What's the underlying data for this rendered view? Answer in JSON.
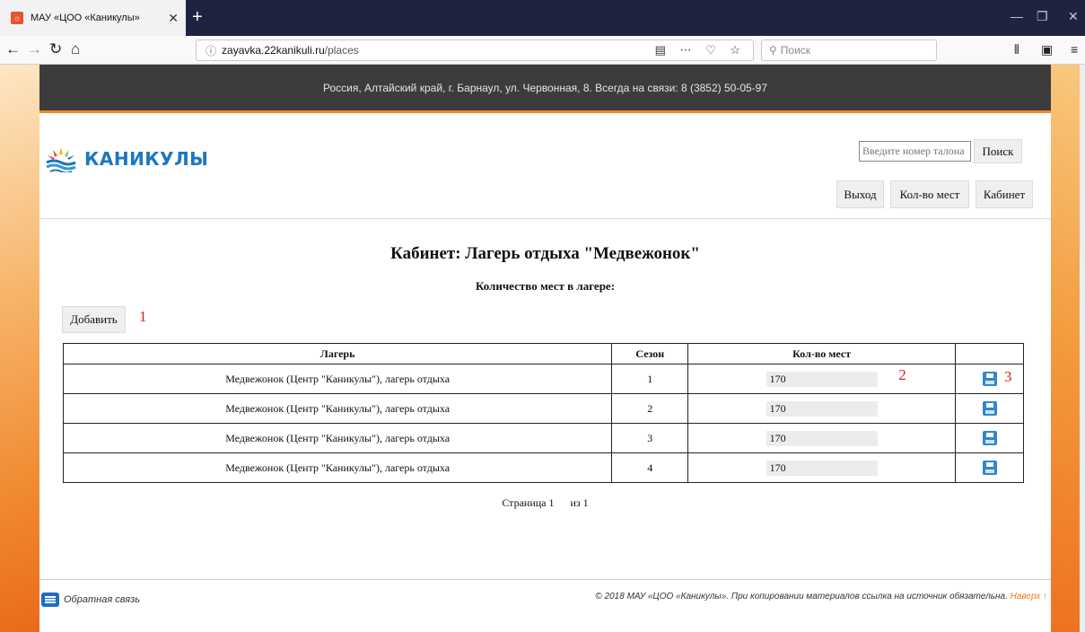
{
  "browser": {
    "tab_title": "МАУ «ЦОО «Каникулы»",
    "url_host": "zayavka.22kanikuli.ru",
    "url_path": "/places",
    "search_placeholder": "Поиск"
  },
  "site": {
    "top_info": "Россия, Алтайский край, г. Барнаул, ул. Червонная, 8.  Всегда на связи: 8 (3852) 50-05-97",
    "logo_text": "КАНИКУЛЫ",
    "search_placeholder": "Введите номер талона",
    "search_button": "Поиск",
    "nav": {
      "logout": "Выход",
      "places": "Кол-во мест",
      "cabinet": "Кабинет"
    }
  },
  "main": {
    "title": "Кабинет: Лагерь отдыха \"Медвежонок\"",
    "subtitle": "Количество мест в лагере:",
    "add_button": "Добавить",
    "markers": {
      "m1": "1",
      "m2": "2",
      "m3": "3"
    },
    "table": {
      "headers": [
        "Лагерь",
        "Сезон",
        "Кол-во мест",
        ""
      ],
      "rows": [
        {
          "camp": "Медвежонок (Центр \"Каникулы\"), лагерь отдыха",
          "season": "1",
          "places": "170"
        },
        {
          "camp": "Медвежонок (Центр \"Каникулы\"), лагерь отдыха",
          "season": "2",
          "places": "170"
        },
        {
          "camp": "Медвежонок (Центр \"Каникулы\"), лагерь отдыха",
          "season": "3",
          "places": "170"
        },
        {
          "camp": "Медвежонок (Центр \"Каникулы\"), лагерь отдыха",
          "season": "4",
          "places": "170"
        }
      ]
    },
    "pager": {
      "page_label": "Страница 1",
      "of_label": "из 1"
    }
  },
  "footer": {
    "feedback": "Обратная связь",
    "copyright": "© 2018 МАУ «ЦОО «Каникулы». При копировании материалов ссылка на источник обязательна.",
    "to_top": "Наверх ↑"
  },
  "icons": {
    "save": "floppy-disk-icon",
    "feedback": "chat-icon"
  },
  "colors": {
    "accent_orange": "#f08a1e",
    "brand_blue": "#1d77bf",
    "save_blue": "#2f87d0",
    "marker_red": "#e0201d"
  }
}
